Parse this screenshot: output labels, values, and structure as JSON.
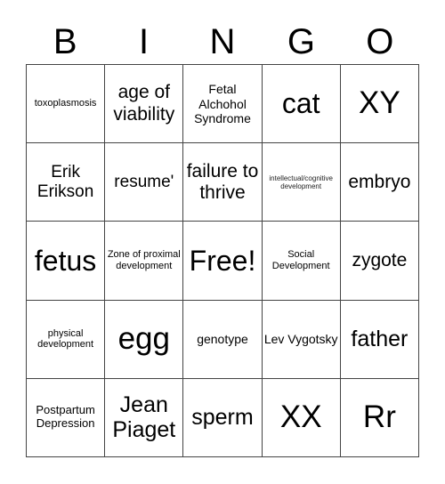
{
  "header": [
    "B",
    "I",
    "N",
    "G",
    "O"
  ],
  "cells": [
    [
      {
        "text": "toxoplasmosis",
        "size": "s-s"
      },
      {
        "text": "age of viability",
        "size": "s-l2"
      },
      {
        "text": "Fetal Alchohol Syndrome",
        "size": "s-m"
      },
      {
        "text": "cat",
        "size": "s-xxl"
      },
      {
        "text": "XY",
        "size": "s-xxxl"
      }
    ],
    [
      {
        "text": "Erik Erikson",
        "size": "s-l"
      },
      {
        "text": "resume'",
        "size": "s-l"
      },
      {
        "text": "failure to thrive",
        "size": "s-l2"
      },
      {
        "text": "intellectual/cognitive development",
        "size": "s-xs"
      },
      {
        "text": "embryo",
        "size": "s-l2"
      }
    ],
    [
      {
        "text": "fetus",
        "size": "s-xxl"
      },
      {
        "text": "Zone of proximal development",
        "size": "s-s"
      },
      {
        "text": "Free!",
        "size": "s-xxl"
      },
      {
        "text": "Social Development",
        "size": "s-s"
      },
      {
        "text": "zygote",
        "size": "s-l2"
      }
    ],
    [
      {
        "text": "physical development",
        "size": "s-s"
      },
      {
        "text": "egg",
        "size": "s-xxxl"
      },
      {
        "text": "genotype",
        "size": "s-m"
      },
      {
        "text": "Lev Vygotsky",
        "size": "s-m"
      },
      {
        "text": "father",
        "size": "s-xl"
      }
    ],
    [
      {
        "text": "Postpartum Depression",
        "size": "s-sm"
      },
      {
        "text": "Jean Piaget",
        "size": "s-xl"
      },
      {
        "text": "sperm",
        "size": "s-xl"
      },
      {
        "text": "XX",
        "size": "s-xxxl"
      },
      {
        "text": "Rr",
        "size": "s-xxxl"
      }
    ]
  ]
}
